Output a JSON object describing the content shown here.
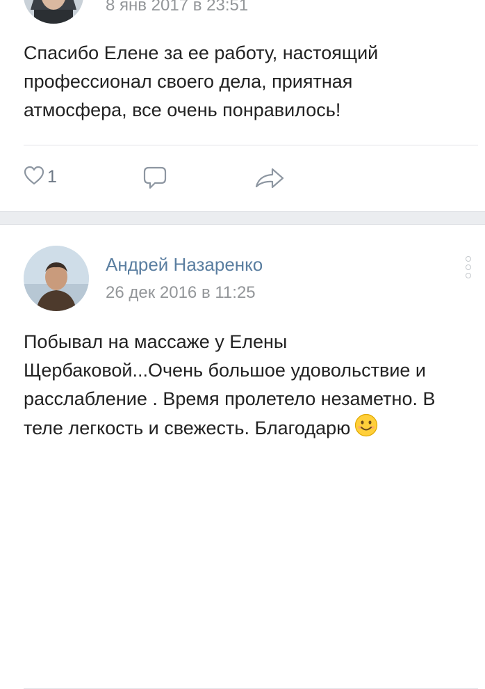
{
  "post1": {
    "date": "8 янв 2017 в 23:51",
    "text": "Спасибо Елене за ее работу,  настоящий профессионал своего дела,  приятная атмосфера,  все очень понравилось!",
    "likes": "1",
    "icons": {
      "like": "heart-icon",
      "comment": "comment-icon",
      "share": "share-icon"
    }
  },
  "post2": {
    "author": "Андрей Назаренко",
    "date": "26 дек 2016 в 11:25",
    "text": "Побывал на массаже у Елены Щербаковой...Очень большое удовольствие и расслабление . Время пролетело незаметно. В теле легкость и свежесть. Благодарю",
    "icons": {
      "emoji": "smiling-face-emoji-icon",
      "more": "more-vertical-icon"
    }
  },
  "colors": {
    "author": "#5a7ea0",
    "meta": "#939699",
    "separator": "#ebedf0",
    "icon": "#6d7885"
  }
}
